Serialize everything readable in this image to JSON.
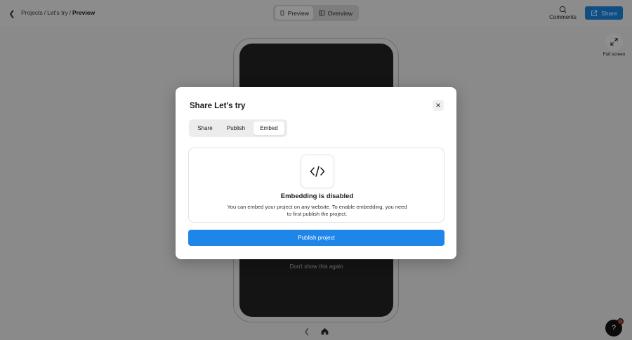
{
  "header": {
    "breadcrumbs": [
      "Projects",
      "/",
      "Let's try",
      "/",
      "Preview"
    ],
    "view_tabs": [
      {
        "label": "Preview",
        "icon": "phone-icon",
        "active": true
      },
      {
        "label": "Overview",
        "icon": "layout-icon",
        "active": false
      }
    ],
    "comments_label": "Comments",
    "share_label": "Share"
  },
  "fullscreen_label": "Full screen",
  "dont_show_label": "Don't show this again",
  "modal": {
    "title": "Share Let's try",
    "tabs": [
      {
        "label": "Share",
        "active": false
      },
      {
        "label": "Publish",
        "active": false
      },
      {
        "label": "Embed",
        "active": true
      }
    ],
    "card": {
      "icon": "code-icon",
      "heading": "Embedding is disabled",
      "description": "You can embed your project on any website. To enable embedding, you need to first publish the project."
    },
    "publish_button": "Publish project"
  },
  "help_icon": "help-icon",
  "colors": {
    "accent": "#1f86e9",
    "share_button": "#104d80",
    "overlay": "#8a8a8a"
  }
}
